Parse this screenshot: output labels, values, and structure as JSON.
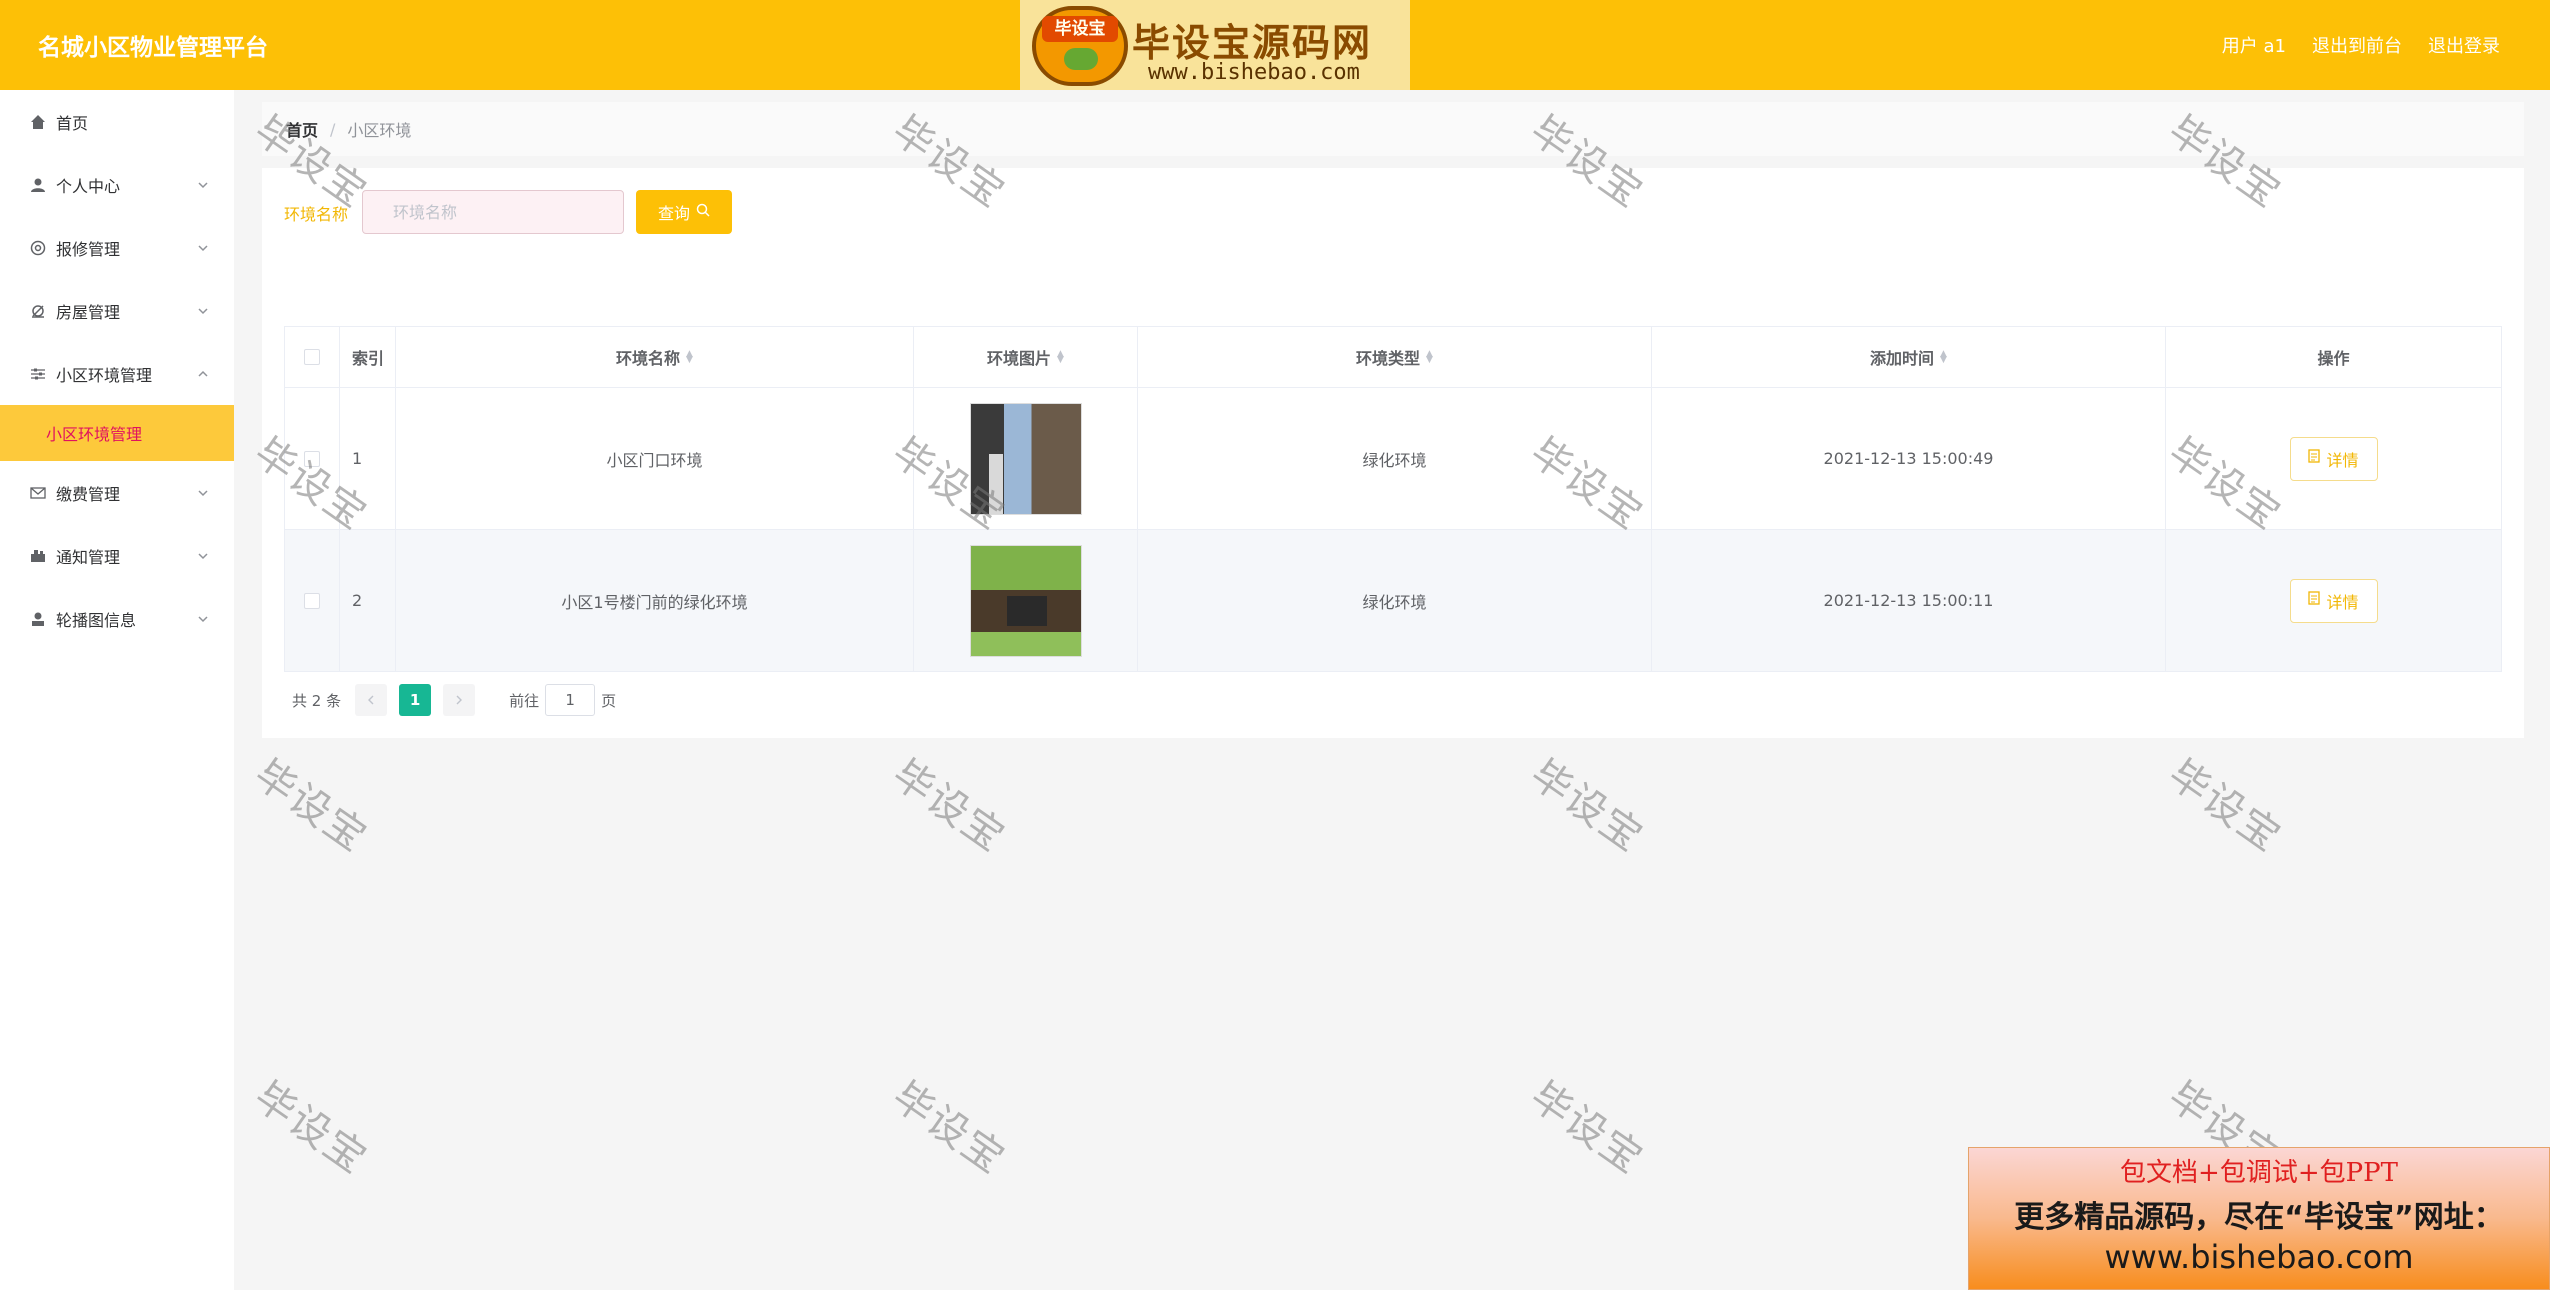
{
  "header": {
    "app_title": "名城小区物业管理平台",
    "user_label": "用户 a1",
    "front_link": "退出到前台",
    "logout_link": "退出登录",
    "logo_badge": "毕设宝",
    "logo_text": "毕设宝源码网",
    "logo_url": "www.bishebao.com"
  },
  "sidebar": {
    "items": [
      {
        "label": "首页",
        "icon": "home-icon"
      },
      {
        "label": "个人中心",
        "icon": "user-icon"
      },
      {
        "label": "报修管理",
        "icon": "repair-icon"
      },
      {
        "label": "房屋管理",
        "icon": "house-icon"
      },
      {
        "label": "小区环境管理",
        "icon": "sliders-icon",
        "expanded": true
      },
      {
        "label": "缴费管理",
        "icon": "mail-icon"
      },
      {
        "label": "通知管理",
        "icon": "notice-icon"
      },
      {
        "label": "轮播图信息",
        "icon": "carousel-icon"
      }
    ],
    "subitem": "小区环境管理"
  },
  "breadcrumb": {
    "home": "首页",
    "separator": "/",
    "current": "小区环境"
  },
  "search": {
    "label": "环境名称",
    "placeholder": "环境名称",
    "button": "查询"
  },
  "table": {
    "columns": [
      "索引",
      "环境名称",
      "环境图片",
      "环境类型",
      "添加时间",
      "操作"
    ],
    "rows": [
      {
        "index": "1",
        "name": "小区门口环境",
        "type": "绿化环境",
        "time": "2021-12-13 15:00:49",
        "action": "详情"
      },
      {
        "index": "2",
        "name": "小区1号楼门前的绿化环境",
        "type": "绿化环境",
        "time": "2021-12-13 15:00:11",
        "action": "详情"
      }
    ]
  },
  "pager": {
    "total": "共 2 条",
    "current_page": "1",
    "goto_prefix": "前往",
    "goto_value": "1",
    "goto_suffix": "页"
  },
  "watermark": "毕设宝",
  "ad": {
    "line1": "包文档+包调试+包PPT",
    "line2": "更多精品源码，尽在“毕设宝”网址：",
    "line3": "www.bishebao.com"
  },
  "colors": {
    "brand": "#fdc006",
    "active_page": "#17b794",
    "submenu_text": "#e0115f"
  }
}
